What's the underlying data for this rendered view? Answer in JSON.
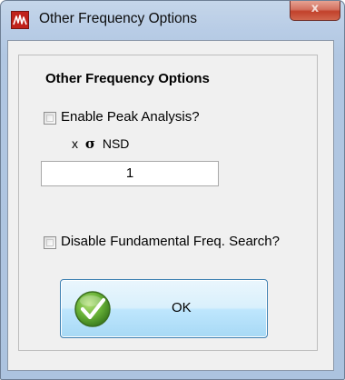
{
  "window": {
    "title": "Other Frequency Options",
    "close_label": "x"
  },
  "dialog": {
    "heading": "Other Frequency Options",
    "peak_analysis": {
      "label": "Enable Peak Analysis?",
      "checked": false
    },
    "nsd": {
      "prefix": "x",
      "symbol": "σ",
      "label": "NSD",
      "value": "1"
    },
    "fundamental_search": {
      "label": "Disable Fundamental Freq. Search?",
      "checked": false
    },
    "ok_button": {
      "label": "OK"
    }
  },
  "icons": {
    "app": "waveform-app-icon",
    "ok": "green-checkmark-icon"
  },
  "colors": {
    "titlebar": "#b9cde6",
    "close_button": "#c2412b",
    "dialog_background": "#f0f0f0",
    "ok_button": "#bee6fd",
    "check_green": "#4f9a2c"
  }
}
